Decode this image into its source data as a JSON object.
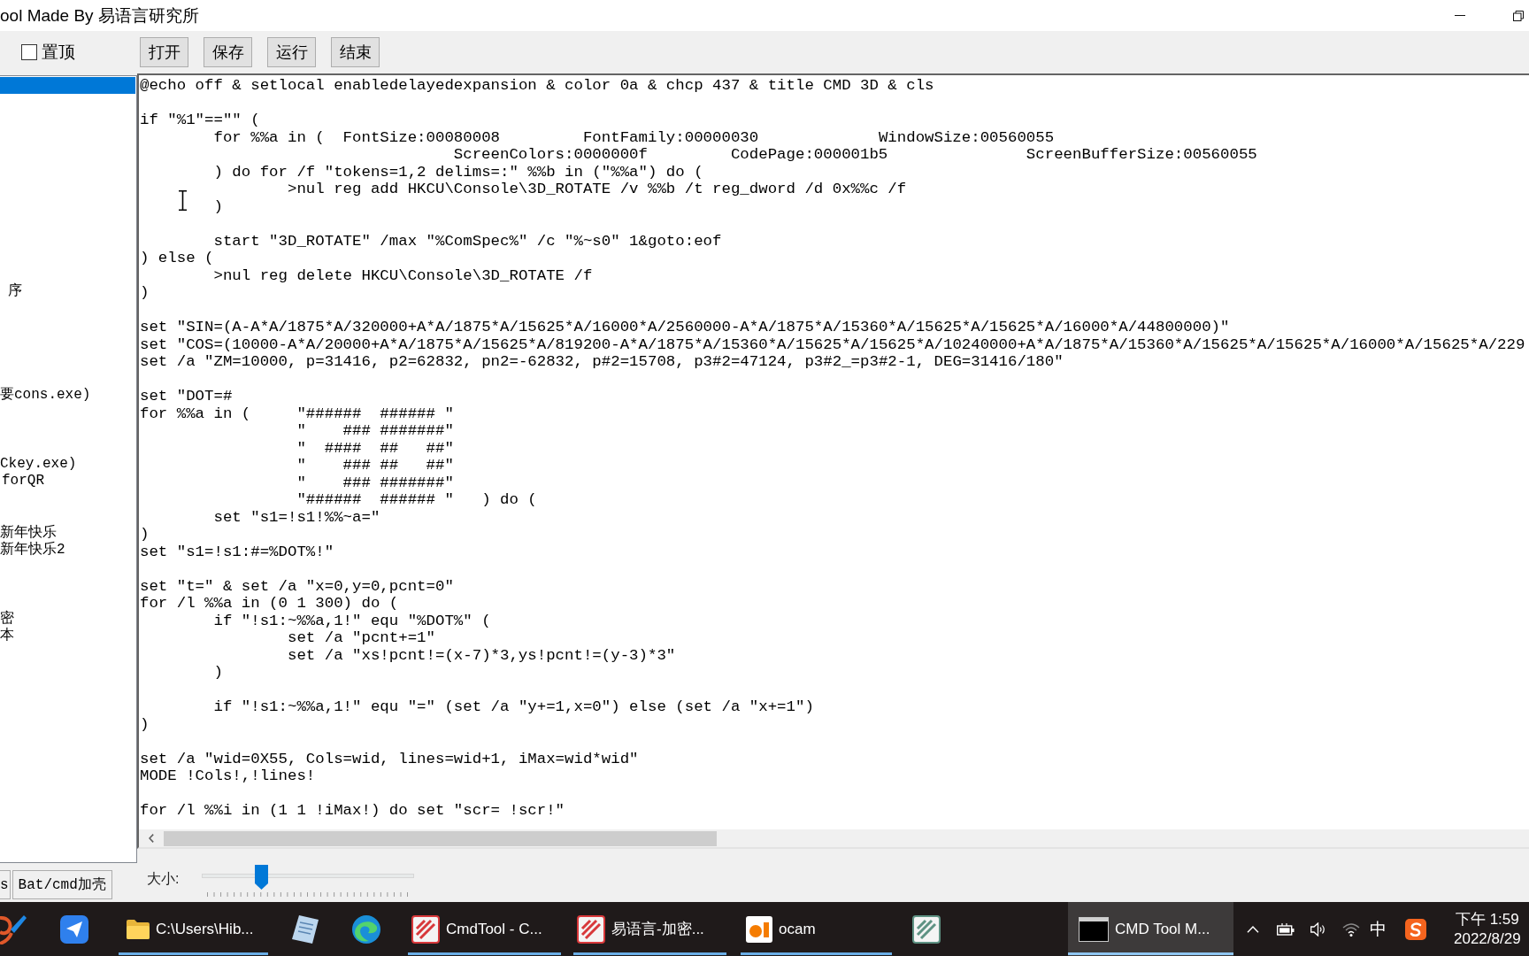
{
  "window": {
    "title": "ool Made By 易语言研究所"
  },
  "toolbar": {
    "pin_checkbox": {
      "label": "置顶",
      "checked": false
    },
    "buttons": [
      "打开",
      "保存",
      "运行",
      "结束"
    ]
  },
  "sidebar": {
    "items": [
      {
        "selected": true
      },
      {
        "label": "序",
        "selected": false
      },
      {
        "label": "要cons.exe)",
        "selected": false
      },
      {
        "label": "Ckey.exe)",
        "selected": false
      },
      {
        "label": "forQR",
        "selected": false
      },
      {
        "label": "新年快乐",
        "selected": false
      },
      {
        "label": "新年快乐2",
        "selected": false
      },
      {
        "label": "密",
        "selected": false
      },
      {
        "label": "本",
        "selected": false
      }
    ],
    "tabs": [
      {
        "label": "s",
        "selected": false
      },
      {
        "label": "Bat/cmd加壳",
        "selected": false
      }
    ]
  },
  "editor": {
    "blocks": [
      [
        "@echo off & setlocal enabledelayedexpansion & color 0a & chcp 437 & title CMD 3D & cls"
      ],
      [
        "if \"%1\"==\"\" (",
        "        for %%a in (  FontSize:00080008         FontFamily:00000030             WindowSize:00560055",
        "                                  ScreenColors:0000000f         CodePage:000001b5               ScreenBufferSize:00560055",
        "        ) do for /f \"tokens=1,2 delims=:\" %%b in (\"%%a\") do (",
        "                >nul reg add HKCU\\Console\\3D_ROTATE /v %%b /t reg_dword /d 0x%%c /f",
        "        )"
      ],
      [
        "        start \"3D_ROTATE\" /max \"%ComSpec%\" /c \"%~s0\" 1&goto:eof",
        ") else (",
        "        >nul reg delete HKCU\\Console\\3D_ROTATE /f",
        ")"
      ],
      [
        "set \"SIN=(A-A*A/1875*A/320000+A*A/1875*A/15625*A/16000*A/2560000-A*A/1875*A/15360*A/15625*A/15625*A/16000*A/44800000)\"",
        "set \"COS=(10000-A*A/20000+A*A/1875*A/15625*A/819200-A*A/1875*A/15360*A/15625*A/15625*A/10240000+A*A/1875*A/15360*A/15625*A/15625*A/16000*A/15625*A/229",
        "set /a \"ZM=10000, p=31416, p2=62832, pn2=-62832, p#2=15708, p3#2=47124, p3#2_=p3#2-1, DEG=31416/180\""
      ],
      [
        "set \"DOT=#",
        "for %%a in (     \"######  ###### \"",
        "                 \"    ### #######\"",
        "                 \"  ####  ##   ##\"",
        "                 \"    ### ##   ##\"",
        "                 \"    ### #######\"",
        "                 \"######  ###### \"   ) do (",
        "        set \"s1=!s1!%%~a=\"",
        ")",
        "set \"s1=!s1:#=%DOT%!\""
      ],
      [
        "set \"t=\" & set /a \"x=0,y=0,pcnt=0\"",
        "for /l %%a in (0 1 300) do (",
        "        if \"!s1:~%%a,1!\" equ \"%DOT%\" (",
        "                set /a \"pcnt+=1\"",
        "                set /a \"xs!pcnt!=(x-7)*3,ys!pcnt!=(y-3)*3\"",
        "        )"
      ],
      [
        "        if \"!s1:~%%a,1!\" equ \"=\" (set /a \"y+=1,x=0\") else (set /a \"x+=1\")",
        ")"
      ],
      [
        "set /a \"wid=0X55, Cols=wid, lines=wid+1, iMax=wid*wid\"",
        "MODE !Cols!,!lines!"
      ],
      [
        "for /l %%i in (1 1 !iMax!) do set \"scr= !scr!\""
      ]
    ]
  },
  "size_slider": {
    "label": "大小:",
    "level": 0.26
  },
  "taskbar": {
    "apps": [
      {
        "label": "C:\\Users\\Hib...",
        "open": true,
        "selected": false
      },
      {
        "label": "CmdTool - C...",
        "open": true,
        "selected": false
      },
      {
        "label": "易语言-加密...",
        "open": true,
        "selected": false
      },
      {
        "label": "ocam",
        "open": true,
        "selected": false
      },
      {
        "label": "CMD Tool M...",
        "open": true,
        "selected": true
      }
    ],
    "tray": {
      "ime": "中",
      "time": "下午 1:59",
      "date": "2022/8/29"
    }
  }
}
